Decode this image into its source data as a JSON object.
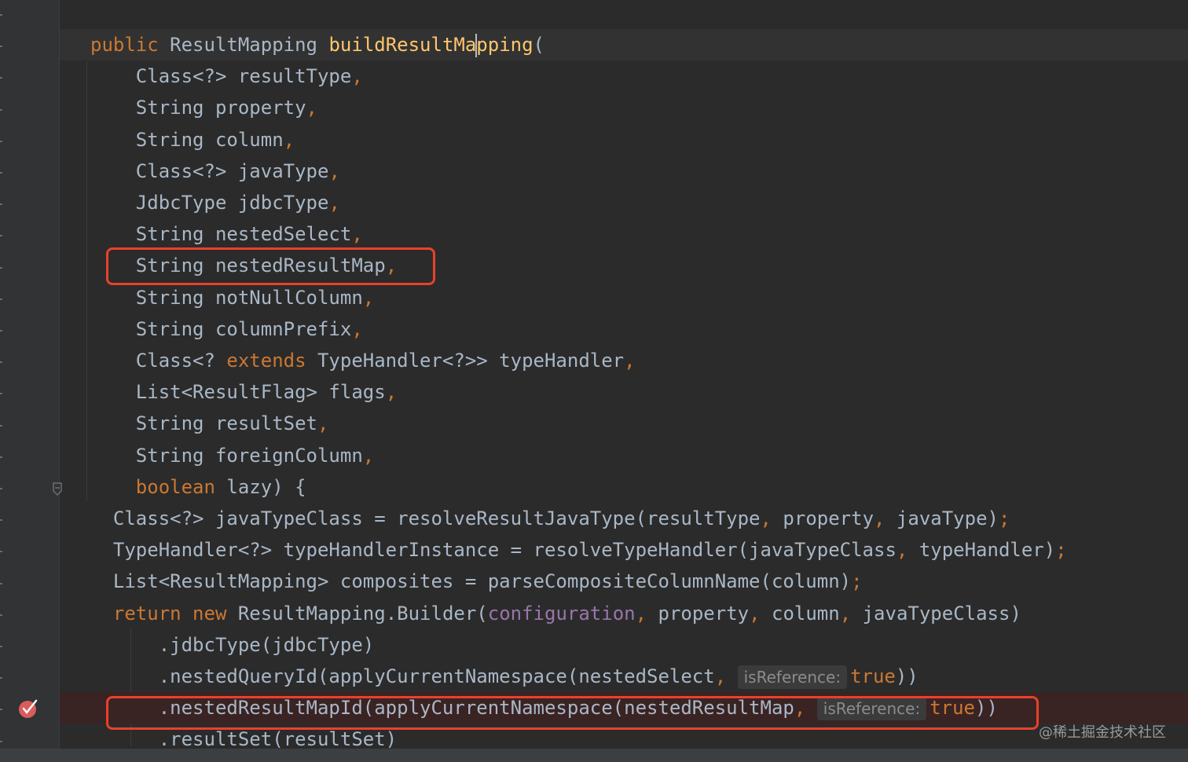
{
  "editor": {
    "lines": [
      [
        {
          "t": "public ",
          "c": "kw"
        },
        {
          "t": "ResultMapping ",
          "c": "txt"
        },
        {
          "t": "buildResultMa",
          "c": "fn"
        },
        {
          "caret": true
        },
        {
          "t": "pping",
          "c": "fn"
        },
        {
          "t": "(",
          "c": "txt"
        }
      ],
      [
        {
          "t": "    Class<?> resultType",
          "c": "txt"
        },
        {
          "t": ",",
          "c": "punc"
        }
      ],
      [
        {
          "t": "    String property",
          "c": "txt"
        },
        {
          "t": ",",
          "c": "punc"
        }
      ],
      [
        {
          "t": "    String column",
          "c": "txt"
        },
        {
          "t": ",",
          "c": "punc"
        }
      ],
      [
        {
          "t": "    Class<?> javaType",
          "c": "txt"
        },
        {
          "t": ",",
          "c": "punc"
        }
      ],
      [
        {
          "t": "    JdbcType jdbcType",
          "c": "txt"
        },
        {
          "t": ",",
          "c": "punc"
        }
      ],
      [
        {
          "t": "    String nestedSelect",
          "c": "txt"
        },
        {
          "t": ",",
          "c": "punc"
        }
      ],
      [
        {
          "t": "    String nestedResultMap",
          "c": "txt"
        },
        {
          "t": ",",
          "c": "punc"
        }
      ],
      [
        {
          "t": "    String notNullColumn",
          "c": "txt"
        },
        {
          "t": ",",
          "c": "punc"
        }
      ],
      [
        {
          "t": "    String columnPrefix",
          "c": "txt"
        },
        {
          "t": ",",
          "c": "punc"
        }
      ],
      [
        {
          "t": "    Class<? ",
          "c": "txt"
        },
        {
          "t": "extends ",
          "c": "kw"
        },
        {
          "t": "TypeHandler<?>> typeHandler",
          "c": "txt"
        },
        {
          "t": ",",
          "c": "punc"
        }
      ],
      [
        {
          "t": "    List<ResultFlag> flags",
          "c": "txt"
        },
        {
          "t": ",",
          "c": "punc"
        }
      ],
      [
        {
          "t": "    String resultSet",
          "c": "txt"
        },
        {
          "t": ",",
          "c": "punc"
        }
      ],
      [
        {
          "t": "    String foreignColumn",
          "c": "txt"
        },
        {
          "t": ",",
          "c": "punc"
        }
      ],
      [
        {
          "t": "    ",
          "c": "txt"
        },
        {
          "t": "boolean ",
          "c": "kw"
        },
        {
          "t": "lazy) {",
          "c": "txt"
        }
      ],
      [
        {
          "t": "  Class<?> javaTypeClass = resolveResultJavaType(resultType",
          "c": "txt"
        },
        {
          "t": ", ",
          "c": "punc"
        },
        {
          "t": "property",
          "c": "txt"
        },
        {
          "t": ", ",
          "c": "punc"
        },
        {
          "t": "javaType)",
          "c": "txt"
        },
        {
          "t": ";",
          "c": "punc"
        }
      ],
      [
        {
          "t": "  TypeHandler<?> typeHandlerInstance = resolveTypeHandler(javaTypeClass",
          "c": "txt"
        },
        {
          "t": ", ",
          "c": "punc"
        },
        {
          "t": "typeHandler)",
          "c": "txt"
        },
        {
          "t": ";",
          "c": "punc"
        }
      ],
      [
        {
          "t": "  List<ResultMapping> composites = parseCompositeColumnName(column)",
          "c": "txt"
        },
        {
          "t": ";",
          "c": "punc"
        }
      ],
      [
        {
          "t": "  ",
          "c": "txt"
        },
        {
          "t": "return new ",
          "c": "kw"
        },
        {
          "t": "ResultMapping.Builder(",
          "c": "txt"
        },
        {
          "t": "configuration",
          "c": "field"
        },
        {
          "t": ", ",
          "c": "punc"
        },
        {
          "t": "property",
          "c": "txt"
        },
        {
          "t": ", ",
          "c": "punc"
        },
        {
          "t": "column",
          "c": "txt"
        },
        {
          "t": ", ",
          "c": "punc"
        },
        {
          "t": "javaTypeClass)",
          "c": "txt"
        }
      ],
      [
        {
          "t": "      .jdbcType(jdbcType)",
          "c": "txt"
        }
      ],
      [
        {
          "t": "      .nestedQueryId(applyCurrentNamespace(nestedSelect",
          "c": "txt"
        },
        {
          "t": ", ",
          "c": "punc"
        },
        {
          "hint": "isReference:"
        },
        {
          "t": "true",
          "c": "kw"
        },
        {
          "t": "))",
          "c": "txt"
        }
      ],
      [
        {
          "t": "      .nestedResultMapId(applyCurrentNamespace(nestedResultMap",
          "c": "txt"
        },
        {
          "t": ", ",
          "c": "punc"
        },
        {
          "hint": "isReference:"
        },
        {
          "t": "true",
          "c": "kw"
        },
        {
          "t": "))",
          "c": "txt"
        }
      ],
      [
        {
          "t": "      .resultSet(resultSet)",
          "c": "txt"
        }
      ]
    ]
  },
  "watermark": "@稀土掘金技术社区",
  "colors": {
    "background": "#2b2b2b",
    "keyword": "#cc7832",
    "function": "#ffc66d",
    "field": "#9876aa",
    "text": "#a9b7c6",
    "highlight": "#e8412c"
  },
  "gutter": {
    "breakpoint_icon": "breakpoint-check-icon",
    "fold_icon": "fold-marker-icon"
  }
}
